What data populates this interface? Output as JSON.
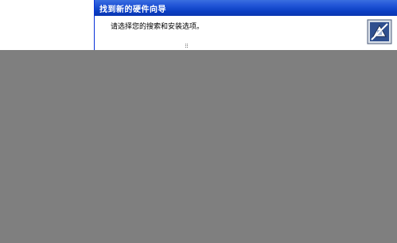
{
  "window": {
    "title": "找到新的硬件向导"
  },
  "header": {
    "prompt": "请选择您的搜索和安装选项。",
    "icon": "hardware-wizard-icon"
  },
  "colors": {
    "title_bar": "#0b3fc4",
    "window_face": "#ece9d8",
    "overlay": "#7f7f7f"
  }
}
